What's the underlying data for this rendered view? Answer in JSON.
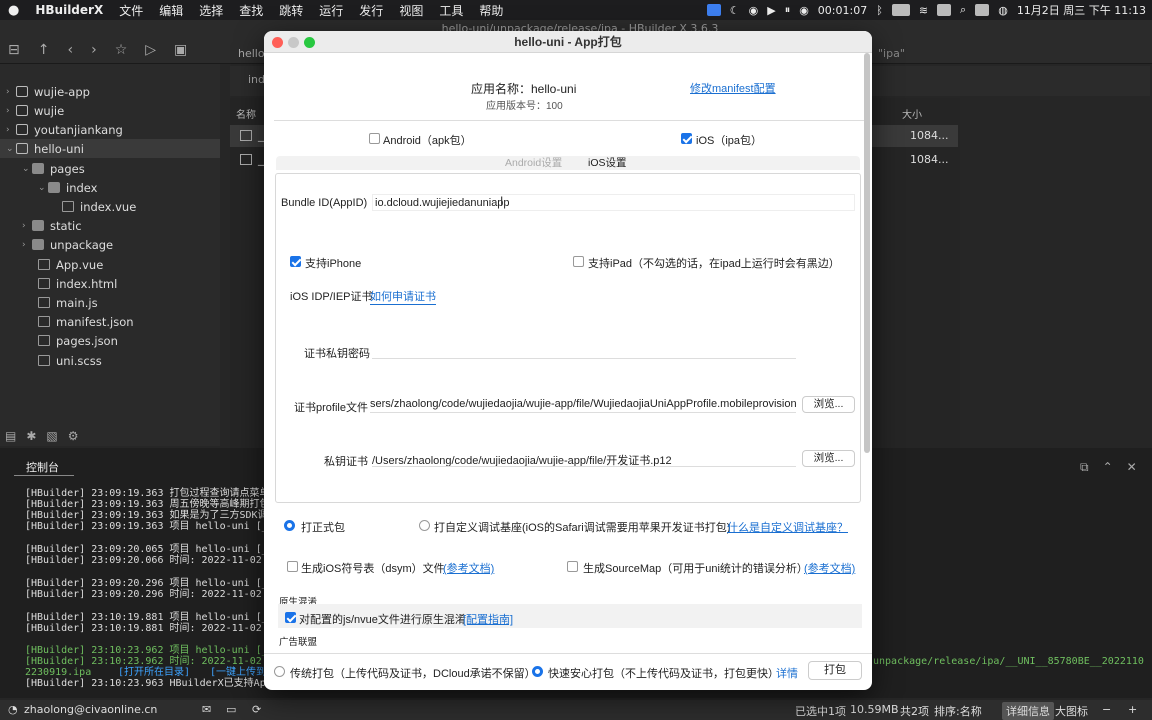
{
  "menubar": {
    "app": "HBuilderX",
    "items": [
      "文件",
      "编辑",
      "选择",
      "查找",
      "跳转",
      "运行",
      "发行",
      "视图",
      "工具",
      "帮助"
    ],
    "timer": "00:01:07",
    "datetime": "11月2日 周三 下午 11:13"
  },
  "window_title": "hello-uni/unpackage/release/ipa - HBuilder X 3.6.3",
  "toolbar": {
    "crumb": "hello-",
    "search_hint": "\"ipa\""
  },
  "sidebar": {
    "items": [
      {
        "label": "wujie-app",
        "type": "proj",
        "depth": 0,
        "arrow": "›"
      },
      {
        "label": "wujie",
        "type": "proj",
        "depth": 0,
        "arrow": "›"
      },
      {
        "label": "youtanjiankang",
        "type": "proj",
        "depth": 0,
        "arrow": "›"
      },
      {
        "label": "hello-uni",
        "type": "proj",
        "depth": 0,
        "arrow": "⌄"
      },
      {
        "label": "pages",
        "type": "fold",
        "depth": 1,
        "arrow": "⌄"
      },
      {
        "label": "index",
        "type": "fold",
        "depth": 2,
        "arrow": "⌄"
      },
      {
        "label": "index.vue",
        "type": "file",
        "depth": 3,
        "arrow": ""
      },
      {
        "label": "static",
        "type": "fold",
        "depth": 1,
        "arrow": "›"
      },
      {
        "label": "unpackage",
        "type": "fold",
        "depth": 1,
        "arrow": "›"
      },
      {
        "label": "App.vue",
        "type": "file",
        "depth": 1,
        "arrow": ""
      },
      {
        "label": "index.html",
        "type": "file",
        "depth": 1,
        "arrow": ""
      },
      {
        "label": "main.js",
        "type": "file",
        "depth": 1,
        "arrow": ""
      },
      {
        "label": "manifest.json",
        "type": "file",
        "depth": 1,
        "arrow": ""
      },
      {
        "label": "pages.json",
        "type": "file",
        "depth": 1,
        "arrow": ""
      },
      {
        "label": "uni.scss",
        "type": "file",
        "depth": 1,
        "arrow": ""
      }
    ]
  },
  "filelist": {
    "tab": "inde",
    "col_name": "名称",
    "col_size": "大小",
    "rows": [
      {
        "name": "__",
        "size": "1084..."
      },
      {
        "name": "__",
        "size": "1084..."
      }
    ]
  },
  "console": {
    "title": "控制台",
    "lines": [
      {
        "t": "[HBuilder] 23:09:19.363 打包过程查询请点菜单发",
        "c": ""
      },
      {
        "t": "[HBuilder] 23:09:19.363 周五傍晚等高峰期打包排",
        "c": ""
      },
      {
        "t": "[HBuilder] 23:09:19.363 如果是为了三方SDK调试",
        "c": ""
      },
      {
        "t": "[HBuilder] 23:09:19.363 项目 hello-uni [__",
        "c": ""
      },
      {
        "t": "",
        "c": ""
      },
      {
        "t": "[HBuilder] 23:09:20.065 项目 hello-uni [__",
        "c": ""
      },
      {
        "t": "[HBuilder] 23:09:20.066 时间: 2022-11-02 2",
        "c": ""
      },
      {
        "t": "",
        "c": ""
      },
      {
        "t": "[HBuilder] 23:09:20.296 项目 hello-uni [__",
        "c": ""
      },
      {
        "t": "[HBuilder] 23:09:20.296 时间: 2022-11-02 2",
        "c": ""
      },
      {
        "t": "",
        "c": ""
      },
      {
        "t": "[HBuilder] 23:10:19.881 项目 hello-uni [__",
        "c": ""
      },
      {
        "t": "[HBuilder] 23:10:19.881 时间: 2022-11-02 2",
        "c": ""
      },
      {
        "t": "",
        "c": ""
      },
      {
        "t": "[HBuilder] 23:10:23.962 项目 hello-uni [__",
        "c": "g"
      },
      {
        "t": "[HBuilder] 23:10:23.962 时间: 2022-11-02 2",
        "c": "g"
      },
      {
        "t": "2230919.ipa",
        "c": "g"
      },
      {
        "t": "[HBuilder] 23:10:23.963 HBuilderX已支持App",
        "c": ""
      }
    ],
    "link_open": "[打开所在目录]",
    "link_upload": "[一键上传到",
    "path_right": "unpackage/release/ipa/__UNI__85780BE__2022110"
  },
  "status": {
    "user": "zhaolong@civaonline.cn",
    "selected": "已选中1项",
    "size": "10.59MB",
    "count": "共2项",
    "sort": "排序:名称",
    "detail": "详细信息",
    "bigicon": "大图标"
  },
  "dialog": {
    "title": "hello-uni - App打包",
    "app_name": "应用名称：hello-uni",
    "app_version": "应用版本号：100",
    "manifest_link": "修改manifest配置",
    "android_label": "Android（apk包）",
    "ios_label": "iOS（ipa包）",
    "tab_android": "Android设置",
    "tab_ios": "iOS设置",
    "bundle_label": "Bundle ID(AppID)",
    "bundle_value": "io.dcloud.wujiejiedanuniapp",
    "iphone_label": "支持iPhone",
    "ipad_label": "支持iPad（不勾选的话，在ipad上运行时会有黑边）",
    "cert_type_label": "iOS IDP/IEP证书",
    "cert_apply_link": "如何申请证书",
    "pwd_label": "证书私钥密码",
    "pwd_value": "",
    "profile_label": "证书profile文件",
    "profile_value": "sers/zhaolong/code/wujiedaojia/wujie-app/file/WujiedaojiaUniAppProfile.mobileprovision",
    "key_label": "私钥证书",
    "key_value": "/Users/zhaolong/code/wujiedaojia/wujie-app/file/开发证书.p12",
    "browse": "浏览...",
    "formal": "打正式包",
    "custom_base": "打自定义调试基座(iOS的Safari调试需要用苹果开发证书打包)",
    "custom_base_link": "什么是自定义调试基座？",
    "dsym": "生成iOS符号表（dsym）文件",
    "ref_doc": "(参考文档)",
    "sourcemap": "生成SourceMap（可用于uni统计的错误分析）",
    "native_mix_title": "原生混淆",
    "native_mix": "对配置的js/nvue文件进行原生混淆",
    "mix_guide": "[配置指南]",
    "ad_title": "广告联盟",
    "traditional": "传统打包（上传代码及证书，DCloud承诺不保留）",
    "fast": "快速安心打包（不上传代码及证书，打包更快）",
    "detail": "详情",
    "pack": "打包"
  },
  "colors": {
    "accent": "#1a73e8",
    "link": "#1a6fd1",
    "green_log": "#6fbf5f"
  }
}
